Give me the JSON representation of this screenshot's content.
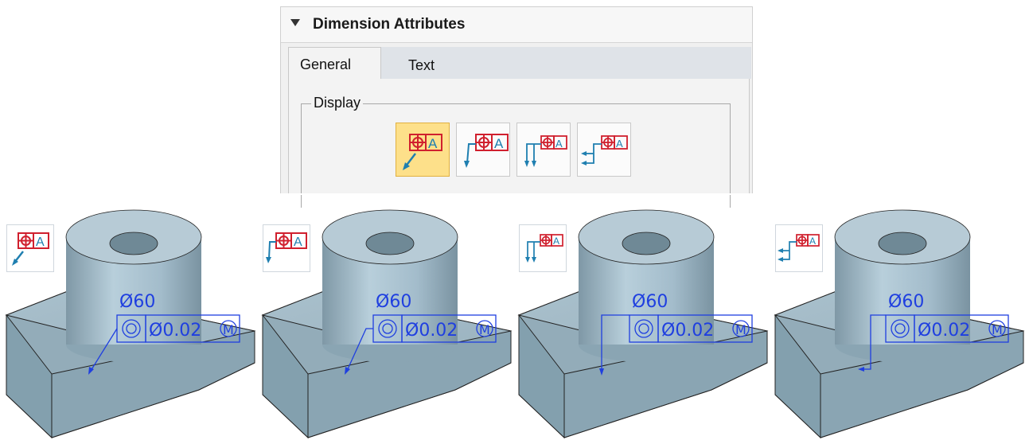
{
  "dialog": {
    "title": "Dimension Attributes",
    "tabs": [
      {
        "label": "General",
        "selected": true
      },
      {
        "label": "Text",
        "selected": false
      }
    ],
    "group_label": "Display",
    "display_buttons": [
      {
        "name": "leader-angled",
        "icon": "leader-angled-icon",
        "selected": true
      },
      {
        "name": "leader-jogged",
        "icon": "leader-jogged-icon",
        "selected": false
      },
      {
        "name": "leader-down",
        "icon": "leader-down-icon",
        "selected": false
      },
      {
        "name": "leader-side",
        "icon": "leader-side-icon",
        "selected": false
      }
    ]
  },
  "frame_text": "A",
  "annotation": {
    "diameter": "Ø60",
    "tolerance": "Ø0.02",
    "modifier": "M",
    "symbol": "concentricity-icon"
  },
  "colors": {
    "frame_red": "#d0202e",
    "leader_blue": "#1f7fb0",
    "annotation_blue": "#1f3fe0",
    "selected_button": "#fde08a",
    "part_fill": "#8fa8b5"
  }
}
